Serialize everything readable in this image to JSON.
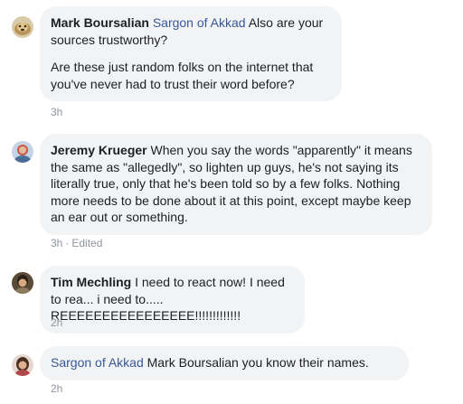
{
  "comments": [
    {
      "author": "Mark Boursalian",
      "mention": "Sargon of Akkad",
      "text_inline": " Also are your sources trustworthy?",
      "paragraph2": "Are these just random folks on the internet that you've never had to trust their word before?",
      "time": "3h",
      "avatar_icon": "profile-photo-icon"
    },
    {
      "author": "Jeremy Krueger",
      "mention": "",
      "text_inline": " When you say the words \"apparently\" it means the same as \"allegedly\", so lighten up guys, he's not saying its literally true, only that he's been told so by a few folks. Nothing more needs to be done about it at this point, except maybe keep an ear out or something.",
      "time": "3h",
      "edited": "Edited",
      "avatar_icon": "profile-photo-icon"
    },
    {
      "author": "Tim Mechling",
      "mention": "",
      "text_inline": " I need to react now! I need to rea... i need to..... REEEEEEEEEEEEEEEE!!!!!!!!!!!!!",
      "time": "2h",
      "avatar_icon": "profile-photo-icon"
    },
    {
      "author": "",
      "mention": "Sargon of Akkad",
      "text_inline": " Mark Boursalian you know their names.",
      "time": "2h",
      "avatar_icon": "profile-photo-icon"
    }
  ],
  "colors": {
    "bubble": "#f2f3f5",
    "link": "#385898",
    "meta": "#90949c",
    "text": "#1c1e21"
  }
}
